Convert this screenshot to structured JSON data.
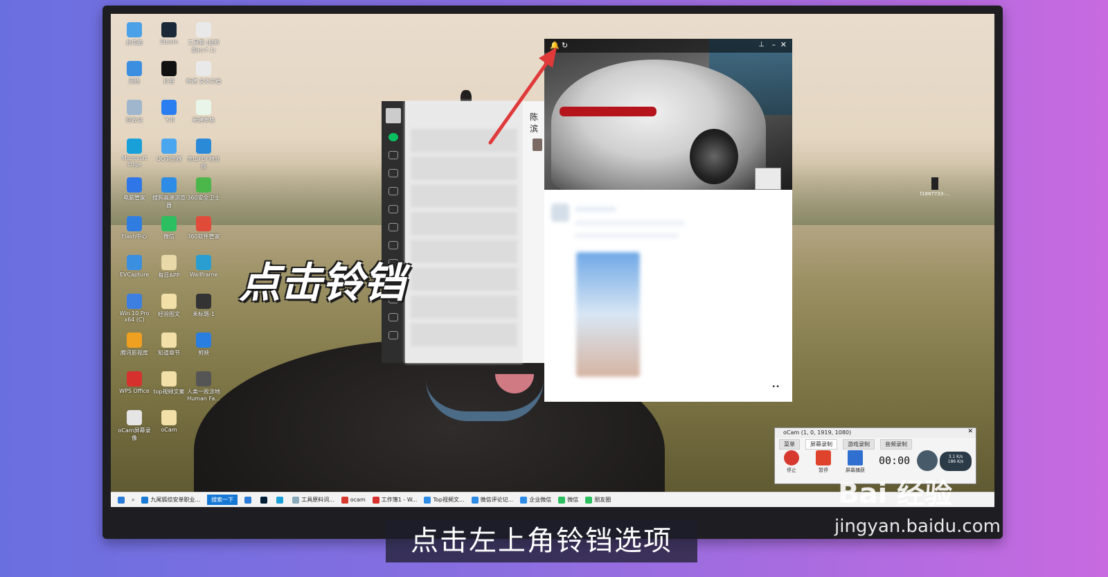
{
  "overlay_title": "点击铃铛",
  "caption": "点击左上角铃铛选项",
  "watermark": {
    "brand": "Bai 经验",
    "url": "jingyan.baidu.com"
  },
  "desktop_icons": [
    {
      "label": "此电脑",
      "color": "#4aa1e8"
    },
    {
      "label": "Steam",
      "color": "#1b2838"
    },
    {
      "label": "工具箱 (最新版)(v7.1)",
      "color": "#e9e9e9"
    },
    {
      "label": "网络",
      "color": "#3b8ee0"
    },
    {
      "label": "抖音",
      "color": "#111111"
    },
    {
      "label": "新建 文本文档",
      "color": "#e9e9e9"
    },
    {
      "label": "回收站",
      "color": "#9fb6cc"
    },
    {
      "label": "飞书",
      "color": "#2a7ef0"
    },
    {
      "label": "新建表格",
      "color": "#e9f5e9"
    },
    {
      "label": "Microsoft Edge",
      "color": "#1aa0d8"
    },
    {
      "label": "QQ浏览器",
      "color": "#4aa6ef"
    },
    {
      "label": "金山PDF独立版",
      "color": "#2b8ad8"
    },
    {
      "label": "电脑管家",
      "color": "#2f77e8"
    },
    {
      "label": "搜狗高速浏览器",
      "color": "#2d8ce6"
    },
    {
      "label": "360安全卫士",
      "color": "#4bb64a"
    },
    {
      "label": "Flash中心",
      "color": "#2f7de0"
    },
    {
      "label": "微信",
      "color": "#2bbf5f"
    },
    {
      "label": "360软件管家",
      "color": "#e04b3a"
    },
    {
      "label": "EVCapture",
      "color": "#3b8fe0"
    },
    {
      "label": "每日APP",
      "color": "#e9d8a8"
    },
    {
      "label": "Wallframe",
      "color": "#2a9ed0"
    },
    {
      "label": "Win 10 Pro x64 (C)",
      "color": "#3c7fe0"
    },
    {
      "label": "经验图文",
      "color": "#f2e0a8"
    },
    {
      "label": "未标题-1",
      "color": "#333333"
    },
    {
      "label": "腾讯影视库",
      "color": "#f0a020"
    },
    {
      "label": "知道章节",
      "color": "#f2e0a8"
    },
    {
      "label": "剪映",
      "color": "#2a7ee0"
    },
    {
      "label": "WPS Office",
      "color": "#d6312d"
    },
    {
      "label": "top视频文案",
      "color": "#f2e0a8"
    },
    {
      "label": "人类一败涂地 Human Fa...",
      "color": "#555555"
    },
    {
      "label": "oCam屏幕录像",
      "color": "#e5e5e5"
    },
    {
      "label": "oCam",
      "color": "#f2e0a8"
    }
  ],
  "right_icon_label": "f1887733-...",
  "wechat": {
    "chat_name": "陈滨"
  },
  "video_window": {
    "bell_icon": "bell-icon",
    "refresh_icon": "refresh-icon"
  },
  "ocam": {
    "title": "oCam (1, 0, 1919, 1080)",
    "tabs": [
      "菜单",
      "屏幕录制",
      "游戏录制",
      "音频录制"
    ],
    "buttons": [
      {
        "label": "停止",
        "color": "#d63a2e"
      },
      {
        "label": "暂停",
        "color": "#e0432c"
      },
      {
        "label": "屏幕捕获",
        "color": "#2f6fd0"
      }
    ],
    "time": "00:00",
    "rate_up": "3.1 K/s",
    "rate_down": "186 K/s"
  },
  "taskbar": [
    {
      "label": "九尾狐综安单职业...",
      "color": "#1a7ad4"
    },
    {
      "label": "搜索一下",
      "color": "#1577d4"
    },
    {
      "label": "",
      "color": "#2a7ad8"
    },
    {
      "label": "",
      "color": "#001e36"
    },
    {
      "label": "",
      "color": "#1aa0d8"
    },
    {
      "label": "工具原料词...",
      "color": "#8ab"
    },
    {
      "label": "ocam",
      "color": "#d63a2e"
    },
    {
      "label": "工作簿1 - W...",
      "color": "#d6312d"
    },
    {
      "label": "Top视频文...",
      "color": "#2d8ce6"
    },
    {
      "label": "微信评论记...",
      "color": "#2d8ce6"
    },
    {
      "label": "企业微信",
      "color": "#2d8ce6"
    },
    {
      "label": "微信",
      "color": "#2bbf5f"
    },
    {
      "label": "朋友圈",
      "color": "#2bbf5f"
    }
  ]
}
